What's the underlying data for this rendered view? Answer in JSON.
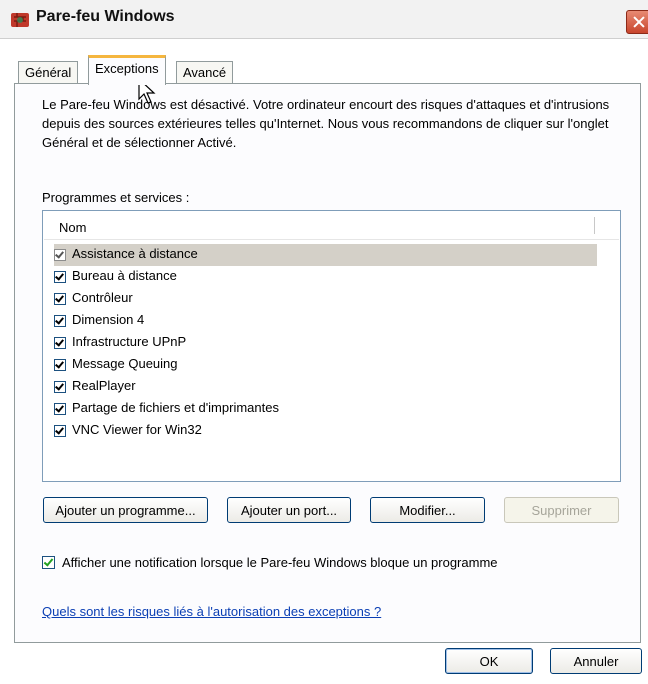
{
  "window": {
    "title": "Pare-feu Windows",
    "icon": "firewall-icon"
  },
  "tabs": [
    {
      "label": "Général"
    },
    {
      "label": "Exceptions",
      "active": true
    },
    {
      "label": "Avancé"
    }
  ],
  "warning_text": "Le Pare-feu Windows est désactivé. Votre ordinateur encourt des risques d'attaques et d'intrusions depuis des sources extérieures telles qu'Internet. Nous vous recommandons de cliquer sur l'onglet Général et de sélectionner Activé.",
  "programs": {
    "label": "Programmes et services :",
    "column_header": "Nom",
    "items": [
      {
        "label": "Assistance à distance",
        "checked": true,
        "selected": true
      },
      {
        "label": "Bureau à distance",
        "checked": true
      },
      {
        "label": "Contrôleur",
        "checked": true
      },
      {
        "label": "Dimension 4",
        "checked": true
      },
      {
        "label": "Infrastructure UPnP",
        "checked": true
      },
      {
        "label": "Message Queuing",
        "checked": true
      },
      {
        "label": "RealPlayer",
        "checked": true
      },
      {
        "label": "Partage de fichiers et d'imprimantes",
        "checked": true
      },
      {
        "label": "VNC Viewer for Win32",
        "checked": true
      }
    ]
  },
  "buttons": {
    "add_program": "Ajouter un programme...",
    "add_port": "Ajouter un port...",
    "modify": "Modifier...",
    "delete": "Supprimer",
    "ok": "OK",
    "cancel": "Annuler"
  },
  "notification": {
    "label": "Afficher une notification lorsque le Pare-feu Windows bloque un programme",
    "checked": true
  },
  "help_link": "Quels sont les risques liés à l'autorisation des exceptions ?",
  "colors": {
    "accent_tab": "#f5b63e",
    "link": "#0b3fb4",
    "checkmark": "#21a121"
  }
}
